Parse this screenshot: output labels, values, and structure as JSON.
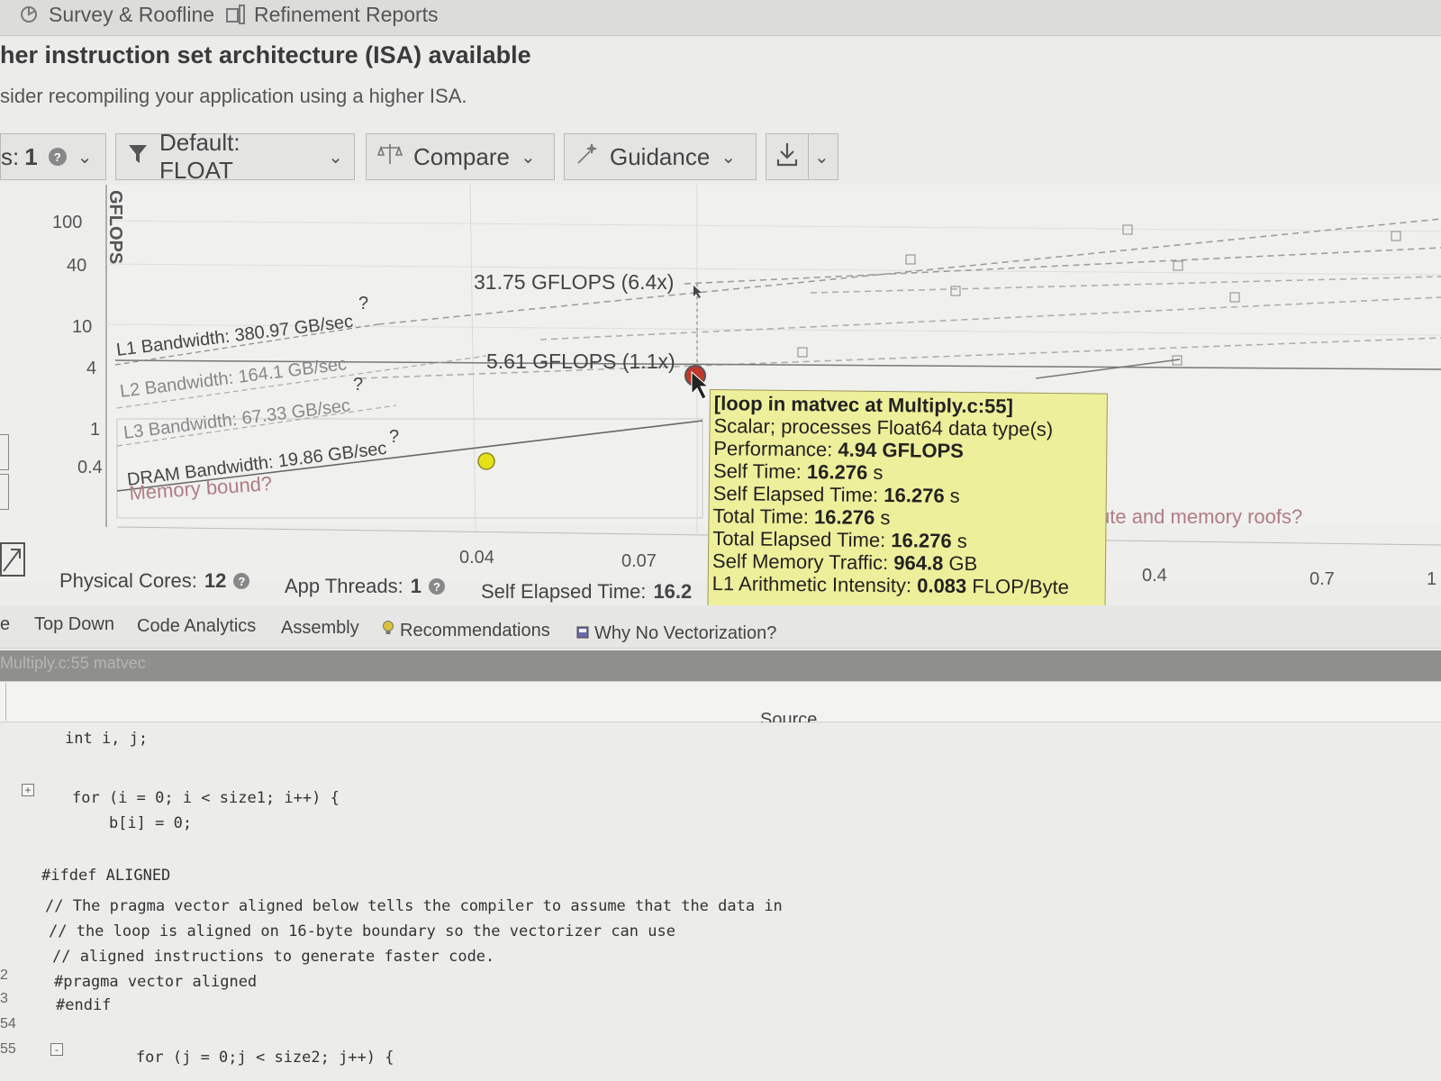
{
  "top_tabs": [
    {
      "label": "Survey & Roofline",
      "icon": "survey-roofline-icon"
    },
    {
      "label": "Refinement Reports",
      "icon": "refinement-reports-icon"
    }
  ],
  "recommendation": {
    "title": "her instruction set architecture (ISA) available",
    "text": "sider recompiling your application using a higher ISA."
  },
  "toolbar": {
    "threads_label": "s:",
    "threads_value": "1",
    "filter_label": "Default: FLOAT",
    "compare_label": "Compare",
    "guidance_label": "Guidance"
  },
  "chart": {
    "ylabel": "GFLOPS",
    "y_ticks": [
      "100",
      "40",
      "10",
      "4",
      "1",
      "0.4"
    ],
    "x_ticks": [
      "0.04",
      "0.07",
      "0.4",
      "0.7",
      "1"
    ],
    "roofs": [
      {
        "label": "L1 Bandwidth: 380.97 GB/sec"
      },
      {
        "label": "L2 Bandwidth: 164.1 GB/sec"
      },
      {
        "label": "L3 Bandwidth: 67.33 GB/sec"
      },
      {
        "label": "DRAM Bandwidth: 19.86 GB/sec"
      }
    ],
    "annotations": {
      "upper": "31.75 GFLOPS (6.4x)",
      "lower": "5.61 GFLOPS (1.1x)",
      "memory_bound": "Memory bound?",
      "roofs_link": "ute and memory roofs?",
      "question": "?"
    },
    "colors": {
      "loop_dot_yellow": "#e6e21a",
      "loop_dot_red": "#c0392b",
      "tooltip_bg": "#eeef9a"
    }
  },
  "tooltip": {
    "title": "[loop in matvec at Multiply.c:55]",
    "subtitle": "Scalar; processes Float64 data type(s)",
    "rows": [
      {
        "label": "Performance:",
        "value": "4.94",
        "unit": "GFLOPS"
      },
      {
        "label": "Self Time:",
        "value": "16.276",
        "unit": "s"
      },
      {
        "label": "Self Elapsed Time:",
        "value": "16.276",
        "unit": "s"
      },
      {
        "label": "Total Time:",
        "value": "16.276",
        "unit": "s"
      },
      {
        "label": "Total Elapsed Time:",
        "value": "16.276",
        "unit": "s"
      },
      {
        "label": "Self Memory Traffic:",
        "value": "964.8",
        "unit": "GB"
      },
      {
        "label": "L1 Arithmetic Intensity:",
        "value": "0.083",
        "unit": "FLOP/Byte"
      }
    ]
  },
  "stats": {
    "physical_cores_label": "Physical Cores:",
    "physical_cores_value": "12",
    "app_threads_label": "App Threads:",
    "app_threads_value": "1",
    "self_elapsed_label": "Self Elapsed Time:",
    "self_elapsed_value": "16.2"
  },
  "bottom_tabs": [
    {
      "label": "e"
    },
    {
      "label": "Top Down"
    },
    {
      "label": "Code Analytics"
    },
    {
      "label": "Assembly"
    },
    {
      "label": "Recommendations",
      "icon": "lightbulb-icon"
    },
    {
      "label": "Why No Vectorization?",
      "icon": "report-icon"
    }
  ],
  "path_bar": "Multiply.c:55 matvec",
  "source": {
    "header": "Source",
    "lines": [
      {
        "num": "",
        "text": "int i, j;"
      },
      {
        "num": "",
        "text": "for (i = 0; i < size1; i++) {"
      },
      {
        "num": "",
        "text": "    b[i] = 0;"
      },
      {
        "num": "",
        "text": "#ifdef ALIGNED"
      },
      {
        "num": "",
        "text": "// The pragma vector aligned below tells the compiler to assume that the data in"
      },
      {
        "num": "",
        "text": "// the loop is aligned on 16-byte boundary so the vectorizer can use"
      },
      {
        "num": "",
        "text": "// aligned instructions to generate faster code."
      },
      {
        "num": "2",
        "text": "#pragma vector aligned"
      },
      {
        "num": "3",
        "text": "#endif"
      },
      {
        "num": "54",
        "text": ""
      },
      {
        "num": "55",
        "text": "    for (j = 0;j < size2; j++) {"
      }
    ]
  }
}
